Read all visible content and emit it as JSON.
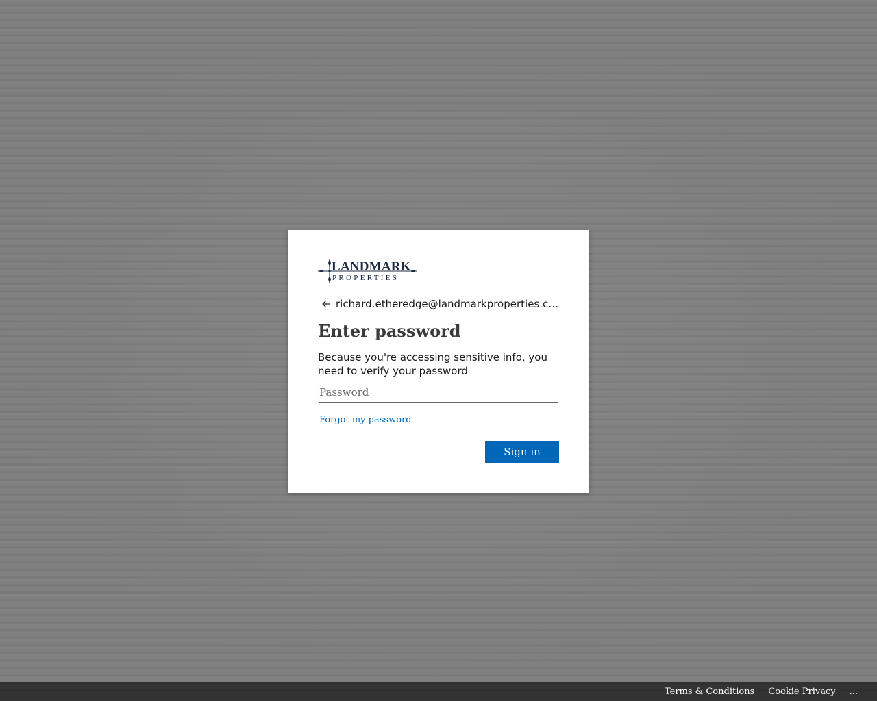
{
  "brand": {
    "logo_line1": "LANDMARK",
    "logo_line2": "PROPERTIES",
    "logo_color": "#1d2a44"
  },
  "identity": {
    "back_icon": "arrow-left-icon",
    "email": "richard.etheredge@landmarkproperties.com"
  },
  "form": {
    "title": "Enter password",
    "description": "Because you're accessing sensitive info, you need to verify your password",
    "password_placeholder": "Password",
    "password_value": "",
    "forgot_link": "Forgot my password",
    "signin_label": "Sign in"
  },
  "footer": {
    "terms": "Terms & Conditions",
    "cookie": "Cookie Privacy",
    "more": "..."
  },
  "colors": {
    "accent": "#0067b8",
    "background": "#7d7d7d",
    "footer_bg": "#333333"
  }
}
